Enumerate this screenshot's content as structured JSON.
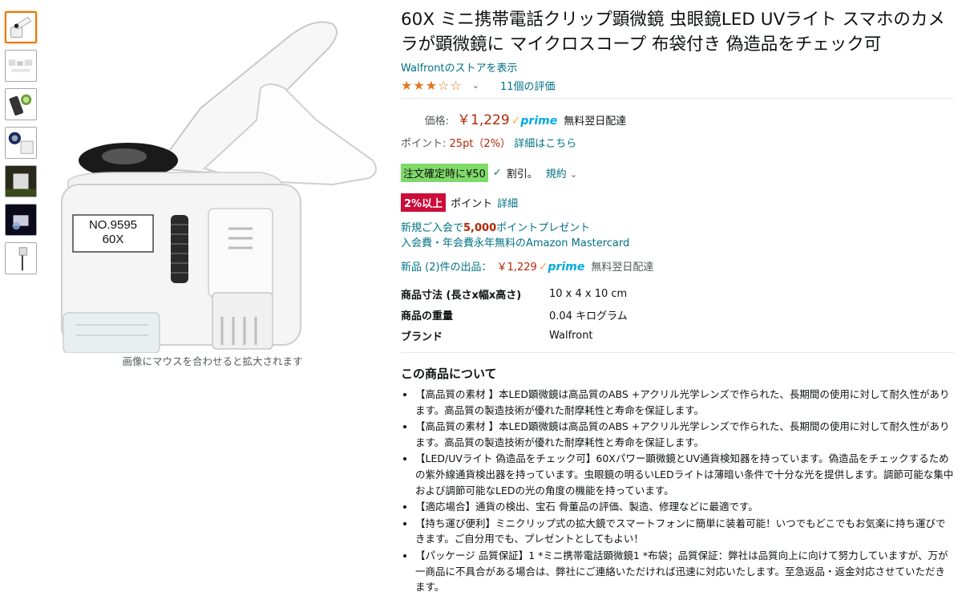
{
  "thumbnails": [
    {
      "name": "thumb-1"
    },
    {
      "name": "thumb-2"
    },
    {
      "name": "thumb-3"
    },
    {
      "name": "thumb-4"
    },
    {
      "name": "thumb-5"
    },
    {
      "name": "thumb-6"
    },
    {
      "name": "thumb-7"
    }
  ],
  "product_image": {
    "label_line1": "NO.9595",
    "label_line2": "60X",
    "hover_hint": "画像にマウスを合わせると拡大されます"
  },
  "title": "60X ミニ携帯電話クリップ顕微鏡 虫眼鏡LED UVライト スマホのカメラが顕微鏡に マイクロスコープ 布袋付き 偽造品をチェック可",
  "store_link": "Walfrontのストアを表示",
  "rating": {
    "stars_display": "★★★☆☆",
    "chevron": "⌄",
    "count_text": "11個の評価",
    "value": 3
  },
  "price": {
    "label": "価格:",
    "value": "￥1,229",
    "prime_check": "✓",
    "prime_text": "prime",
    "delivery": "無料翌日配達"
  },
  "points": {
    "label": "ポイント:",
    "value": "25pt（2%）",
    "details_link": "詳細はこちら"
  },
  "coupon": {
    "badge": "注文確定時に¥50",
    "check": "✓",
    "discount_text": "割引。",
    "terms_link": "規約",
    "terms_chevron": "⌄"
  },
  "points_promo": {
    "badge": "2%以上",
    "text": "ポイント",
    "details_link": "詳細"
  },
  "card_offer": {
    "line1_prefix": "新規ご入会で",
    "line1_amount": "5,000",
    "line1_suffix": "ポイントプレゼント",
    "line2": "入会費・年会費永年無料のAmazon Mastercard"
  },
  "new_offers": {
    "link": "新品 (2)件の出品：",
    "price": "￥1,229",
    "prime_check": "✓",
    "prime_text": "prime",
    "delivery": "無料翌日配達"
  },
  "specs": [
    {
      "key": "商品寸法 (長さx幅x高さ)",
      "value": "10 x 4 x 10 cm"
    },
    {
      "key": "商品の重量",
      "value": "0.04 キログラム"
    },
    {
      "key": "ブランド",
      "value": "Walfront"
    }
  ],
  "about": {
    "heading": "この商品について",
    "bullets": [
      "【高品質の素材 】本LED顕微鏡は高品質のABS +アクリル光学レンズで作られた、長期間の使用に対して耐久性があります。高品質の製造技術が優れた耐摩耗性と寿命を保証します。",
      "【高品質の素材 】本LED顕微鏡は高品質のABS +アクリル光学レンズで作られた、長期間の使用に対して耐久性があります。高品質の製造技術が優れた耐摩耗性と寿命を保証します。",
      "【LED/UVライト 偽造品をチェック可】60Xパワー顕微鏡とUV通貨検知器を持っています。偽造品をチェックするための紫外線通貨検出器を持っています。虫眼鏡の明るいLEDライトは薄暗い条件で十分な光を提供します。調節可能な集中および調節可能なLEDの光の角度の機能を持っています。",
      "【適応場合】通貨の検出、宝石 骨董品の評価、製造、修理などに最適です。",
      "【持ち運び便利】ミニクリップ式の拡大鏡でスマートフォンに簡単に装着可能！いつでもどこでもお気楽に持ち運びできます。ご自分用でも、プレゼントとしてもよい！",
      "【パッケージ 品質保証】1 *ミニ携帯電話顕微鏡1 *布袋；品質保証：弊社は品質向上に向けて努力していますが、万が一商品に不具合がある場合は、弊社にご連絡いただければ迅速に対応いたします。至急返品・返金対応させていただきます。"
    ]
  },
  "colors": {
    "link": "#007185",
    "price": "#b12704",
    "star": "#de7921",
    "prime": "#00a8e1",
    "coupon_bg": "#7fda69",
    "badge_red": "#cc0c39",
    "thumb_selected": "#e77600"
  }
}
